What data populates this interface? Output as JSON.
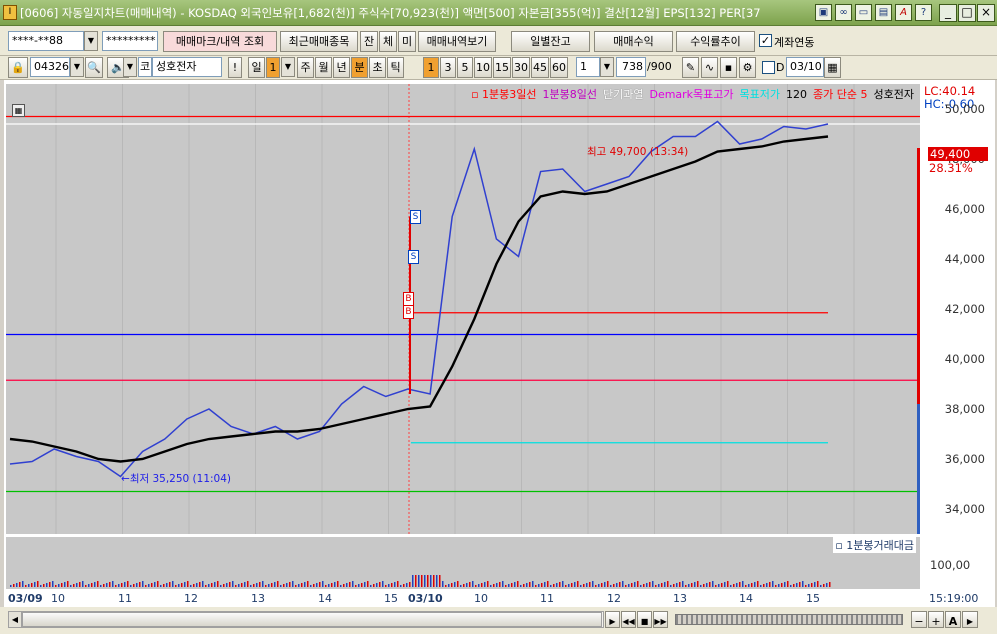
{
  "window": {
    "title": "[0606] 자동일지차트(매매내역) - KOSDAQ 외국인보유[1,682(천)] 주식수[70,923(천)] 액면[500] 자본금[355(억)] 결산[12월] EPS[132] PER[37"
  },
  "toolbar1": {
    "account": "****-**88",
    "password": "*********",
    "btn_mark": "매매마크/내역 조회",
    "btn_recent": "최근매매종목",
    "btn_jan": "잔",
    "btn_che": "체",
    "btn_mi": "미",
    "btn_history": "매매내역보기",
    "btn_daily": "일별잔고",
    "btn_profit": "매매수익",
    "btn_yield": "수익률추이",
    "link_label": "계좌연동",
    "link_checked": true
  },
  "toolbar2": {
    "code": "043260",
    "market": "코",
    "stock_name": "성호전자",
    "period_buttons": [
      "일",
      "주",
      "월",
      "년",
      "분",
      "초",
      "틱"
    ],
    "period_selected": "분",
    "day_value": "1",
    "minute_buttons": [
      "1",
      "3",
      "5",
      "10",
      "15",
      "30",
      "45",
      "60"
    ],
    "minute_selected": "1",
    "count_value": "1",
    "data_count": "738",
    "data_max": "/900",
    "checkbox_label": "D",
    "date_value": "03/10"
  },
  "legend": [
    {
      "label": "1분봉3일선",
      "color": "#ff0000"
    },
    {
      "label": "1분봉8일선",
      "color": "#c000c0"
    },
    {
      "label": "단기과열",
      "color": "#ffffff"
    },
    {
      "label": "Demark목표고가",
      "color": "#e000e0"
    },
    {
      "label": "목표저가",
      "color": "#00e0e0"
    },
    {
      "label": "120",
      "color": "#000000"
    },
    {
      "label": "종가 단순 5",
      "color": "#ff0000"
    },
    {
      "label": "성호전자",
      "color": "#000000"
    }
  ],
  "indicators": {
    "lc": "LC:40.14",
    "hc": "HC:-0.60"
  },
  "annotations": {
    "high": "최고 49,700 (13:34)",
    "low": "최저 35,250 (11:04)",
    "sell1": "S",
    "sell2": "S",
    "buy1": "B",
    "buy2": "B"
  },
  "price_badge": {
    "value": "49,400",
    "pct": "28.31%"
  },
  "vol_legend": "1분봉거래대금",
  "vol_ylabel": "100,00",
  "time_label": "15:19:00",
  "chart_data": {
    "type": "line",
    "y_ticks": [
      "50,000",
      "48,000",
      "46,000",
      "44,000",
      "42,000",
      "40,000",
      "38,000",
      "36,000",
      "34,000"
    ],
    "ylim": [
      33000,
      51000
    ],
    "x_ticks": [
      "03/09",
      "10",
      "11",
      "12",
      "13",
      "14",
      "15",
      "03/10",
      "10",
      "11",
      "12",
      "13",
      "14",
      "15"
    ],
    "series": [
      {
        "name": "성호전자",
        "values": [
          35800,
          35900,
          36400,
          36100,
          35900,
          35300,
          36300,
          36800,
          37600,
          38000,
          37300,
          37000,
          37300,
          36800,
          37100,
          38200,
          38900,
          38500,
          38800,
          38600,
          45700,
          48400,
          44800,
          44100,
          47500,
          47600,
          46700,
          47000,
          47300,
          48300,
          48900,
          48900,
          49500,
          48600,
          48800,
          49300,
          49200,
          49400
        ]
      },
      {
        "name": "120",
        "values": [
          36800,
          36700,
          36500,
          36300,
          36000,
          35900,
          36000,
          36300,
          36600,
          36800,
          36900,
          37000,
          37100,
          37100,
          37200,
          37400,
          37600,
          37800,
          38000,
          38100,
          39700,
          41600,
          43800,
          45500,
          46500,
          46700,
          46600,
          46700,
          47000,
          47300,
          47600,
          47900,
          48300,
          48400,
          48500,
          48700,
          48800,
          48900
        ]
      }
    ],
    "hlines": [
      {
        "value": 49700,
        "color": "#ff0000"
      },
      {
        "value": 49400,
        "color": "#ffffff"
      },
      {
        "value": 41850,
        "color": "#ff0000"
      },
      {
        "value": 40980,
        "color": "#0000ff"
      },
      {
        "value": 39150,
        "color": "#ff0040"
      },
      {
        "value": 36650,
        "color": "#00e0e0"
      },
      {
        "value": 34700,
        "color": "#00c000"
      }
    ]
  }
}
